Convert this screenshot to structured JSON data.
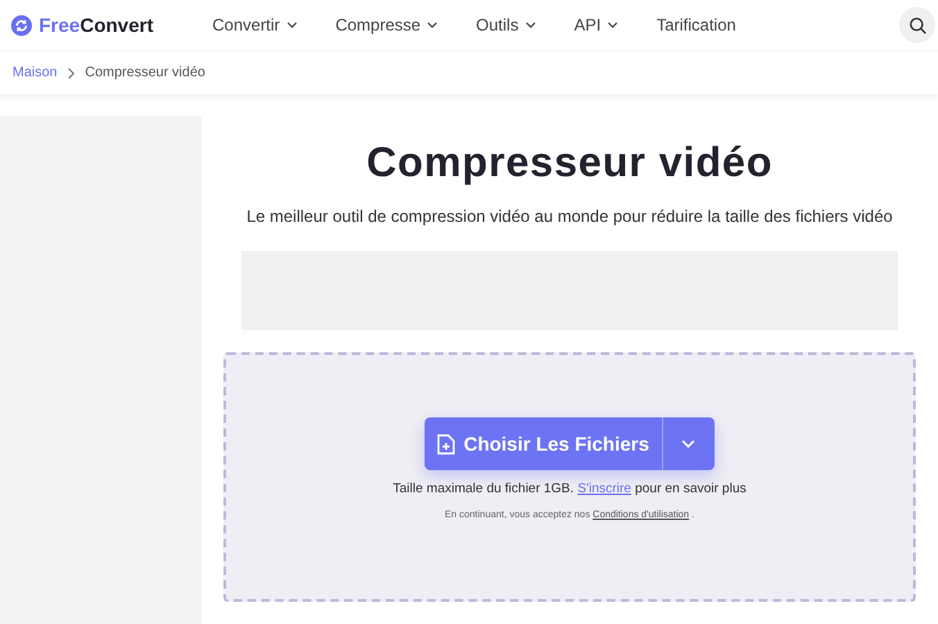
{
  "logo": {
    "parts": [
      "Free",
      "Convert"
    ]
  },
  "nav": [
    {
      "label": "Convertir",
      "dropdown": true
    },
    {
      "label": "Compresse",
      "dropdown": true
    },
    {
      "label": "Outils",
      "dropdown": true
    },
    {
      "label": "API",
      "dropdown": true
    },
    {
      "label": "Tarification",
      "dropdown": false
    }
  ],
  "breadcrumb": [
    "Maison",
    "Compresseur vidéo"
  ],
  "title": "Compresseur vidéo",
  "subtitle": "Le meilleur outil de compression vidéo au monde pour réduire la taille des fichiers vidéo",
  "upload": {
    "button": "Choisir Les Fichiers",
    "limit": {
      "before": "Taille maximale du fichier 1GB. ",
      "link": "S'inscrire",
      "after": " pour en savoir plus"
    },
    "legal": {
      "before": "En continuant, vous acceptez nos ",
      "link": "Conditions d'utilisation",
      "after": " ."
    }
  }
}
